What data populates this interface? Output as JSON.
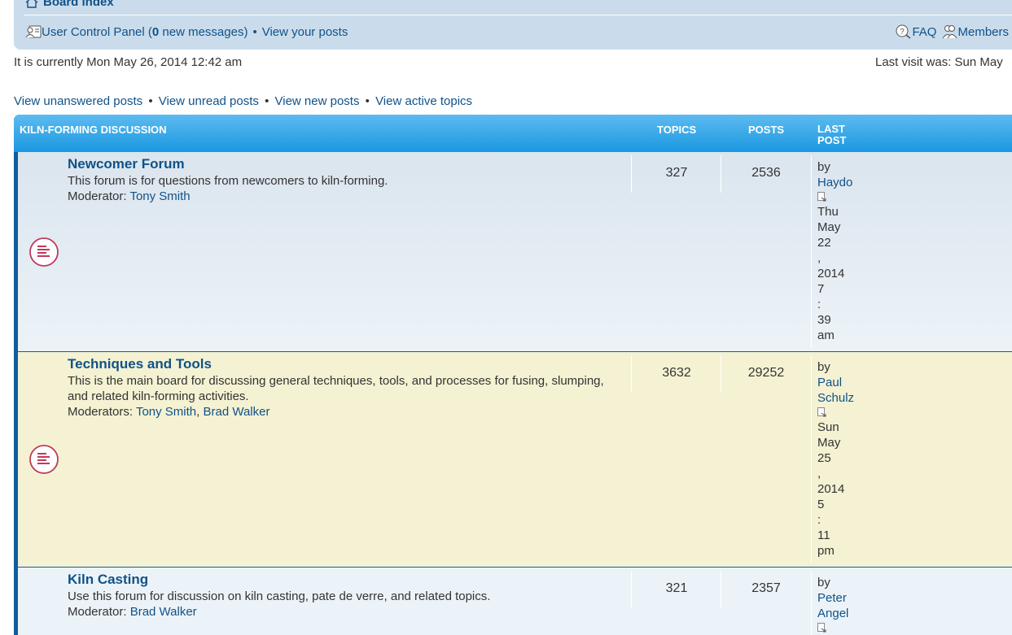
{
  "nav": {
    "board_index": "Board index",
    "ucp_label": "User Control Panel (",
    "new_messages_count": "0",
    "new_messages_suffix": " new messages)",
    "bullet": "•",
    "view_your_posts": "View your posts",
    "faq": "FAQ",
    "members": "Members"
  },
  "status": {
    "current_time": "It is currently Mon May 26, 2014 12:42 am",
    "last_visit": "Last visit was: Sun May"
  },
  "quick_links": {
    "unanswered": "View unanswered posts",
    "unread": "View unread posts",
    "new": "View new posts",
    "active": "View active topics",
    "sep": "•"
  },
  "table": {
    "category": "KILN-FORMING DISCUSSION",
    "col_topics": "TOPICS",
    "col_posts": "POSTS",
    "col_last_post": "LAST POST"
  },
  "forums": [
    {
      "title": "Newcomer Forum",
      "description": "This forum is for questions from newcomers to kiln-forming.",
      "mod_label": "Moderator: ",
      "moderators": "Tony Smith",
      "moderators_2": "",
      "topics": "327",
      "posts": "2536",
      "last_by": "by",
      "last_author": "Haydo",
      "last_date": [
        "Thu",
        "May",
        "22",
        ",",
        "2014",
        "7",
        ":",
        "39",
        "am"
      ]
    },
    {
      "title": "Techniques and Tools",
      "description": "This is the main board for discussing general techniques, tools, and processes for fusing, slumping, and related kiln-forming activities.",
      "mod_label": "Moderators: ",
      "moderators": "Tony Smith",
      "moderators_2": "Brad Walker",
      "topics": "3632",
      "posts": "29252",
      "last_by": "by",
      "last_author": "Paul Schulz",
      "last_date": [
        "Sun",
        "May",
        "25",
        ",",
        "2014",
        "5",
        ":",
        "11",
        "pm"
      ]
    },
    {
      "title": "Kiln Casting",
      "description": "Use this forum for discussion on kiln casting, pate de verre, and related topics.",
      "mod_label": "Moderator: ",
      "moderators": "Brad Walker",
      "moderators_2": "",
      "topics": "321",
      "posts": "2357",
      "last_by": "by",
      "last_author": "Peter Angel",
      "last_date": []
    }
  ],
  "colors": {
    "link": "#105289",
    "nav_bg": "#cadceb",
    "header_top": "#5dbbf0",
    "header_bottom": "#1a98e0",
    "row_alt": "#f4f2d2",
    "icon_red": "#c0395a"
  },
  "icons": {
    "board_index": "home-icon",
    "ucp": "user-card-icon",
    "faq": "question-icon",
    "members": "members-icon",
    "forum_read": "forum-read-icon",
    "view_latest": "view-latest-post-icon"
  }
}
